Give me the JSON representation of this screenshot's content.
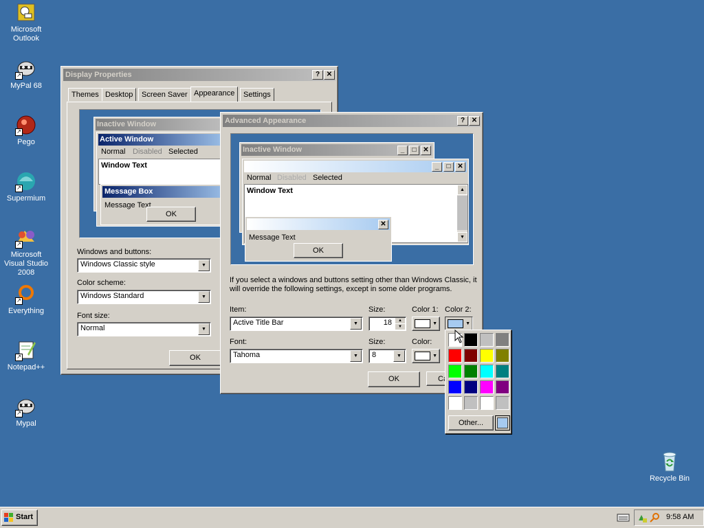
{
  "desktop": {
    "icons": [
      {
        "label": "Microsoft Outlook",
        "icon": "outlook-icon"
      },
      {
        "label": "MyPal 68",
        "icon": "raccoon-icon"
      },
      {
        "label": "Pego",
        "icon": "pego-icon"
      },
      {
        "label": "Supermium",
        "icon": "supermium-icon"
      },
      {
        "label": "Microsoft Visual Studio 2008",
        "icon": "visual-studio-icon"
      },
      {
        "label": "Everything",
        "icon": "everything-icon"
      },
      {
        "label": "Notepad++",
        "icon": "notepadpp-icon"
      },
      {
        "label": "Mypal",
        "icon": "raccoon-icon"
      }
    ],
    "recycle_bin": "Recycle Bin",
    "background": "#3a6ea5"
  },
  "display_properties": {
    "title": "Display Properties",
    "tabs": [
      "Themes",
      "Desktop",
      "Screen Saver",
      "Appearance",
      "Settings"
    ],
    "selected_tab": "Appearance",
    "preview": {
      "inactive_title": "Inactive Window",
      "active_title": "Active Window",
      "menu": [
        "Normal",
        "Disabled",
        "Selected"
      ],
      "window_text": "Window Text",
      "msgbox_title": "Message Box",
      "msgbox_text": "Message Text",
      "ok": "OK"
    },
    "windows_buttons_label": "Windows and buttons:",
    "windows_buttons_value": "Windows Classic style",
    "color_scheme_label": "Color scheme:",
    "color_scheme_value": "Windows Standard",
    "font_size_label": "Font size:",
    "font_size_value": "Normal",
    "ok": "OK"
  },
  "advanced": {
    "title": "Advanced Appearance",
    "preview": {
      "inactive_title": "Inactive Window",
      "menu": [
        "Normal",
        "Disabled",
        "Selected"
      ],
      "window_text": "Window Text",
      "msgbox_text": "Message Text",
      "ok": "OK"
    },
    "info": "If you select a windows and buttons setting other than Windows Classic, it will override the following settings, except in some older programs.",
    "item_label": "Item:",
    "item_value": "Active Title Bar",
    "size_label": "Size:",
    "size_value": "18",
    "color1_label": "Color 1:",
    "color2_label": "Color 2:",
    "font_label": "Font:",
    "font_value": "Tahoma",
    "font_size_label": "Size:",
    "font_size_value": "8",
    "color_label": "Color:",
    "ok": "OK",
    "cancel_partial": "Ca"
  },
  "color_picker": {
    "colors": [
      "#ffffff",
      "#000000",
      "#c0c0c0",
      "#808080",
      "#ff0000",
      "#800000",
      "#ffff00",
      "#808000",
      "#00ff00",
      "#008000",
      "#00ffff",
      "#008080",
      "#0000ff",
      "#000080",
      "#ff00ff",
      "#800080",
      "#ffffff",
      "#c0c0c0",
      "#ffffff",
      "#c0c0c0"
    ],
    "other": "Other...",
    "current": "#a6caf0"
  },
  "taskbar": {
    "start": "Start",
    "time": "9:58 AM"
  }
}
